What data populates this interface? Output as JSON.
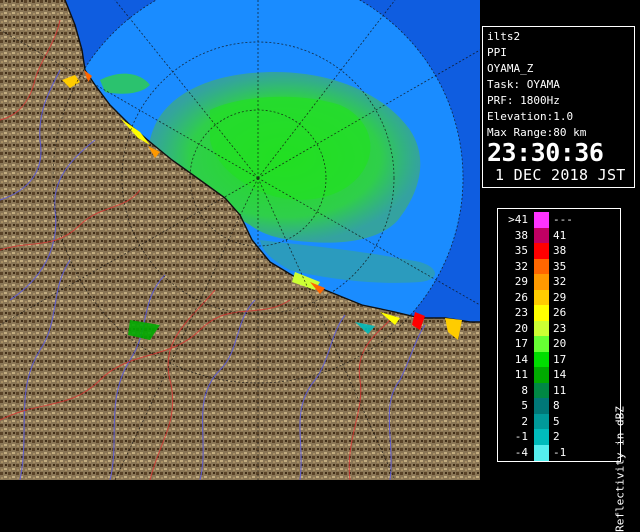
{
  "info": {
    "lines": [
      "ilts2",
      "PPI",
      "OYAMA_Z",
      "Task: OYAMA",
      "PRF: 1800Hz",
      "Elevation:1.0",
      "Max Range:80 km"
    ],
    "time": "23:30:36",
    "date": "1 DEC 2018 JST"
  },
  "legend": {
    "unit_label": "Reflectivity in dBZ",
    "rows": [
      {
        "low": ">41",
        "high": "---",
        "color": "#ff33ff"
      },
      {
        "low": "38",
        "high": "41",
        "color": "#c00063"
      },
      {
        "low": "35",
        "high": "38",
        "color": "#ff0000"
      },
      {
        "low": "32",
        "high": "35",
        "color": "#ff6600"
      },
      {
        "low": "29",
        "high": "32",
        "color": "#ff9900"
      },
      {
        "low": "26",
        "high": "29",
        "color": "#ffcc00"
      },
      {
        "low": "23",
        "high": "26",
        "color": "#ffff00"
      },
      {
        "low": "20",
        "high": "23",
        "color": "#ccff33"
      },
      {
        "low": "17",
        "high": "20",
        "color": "#66ff33"
      },
      {
        "low": "14",
        "high": "17",
        "color": "#00dd00"
      },
      {
        "low": "11",
        "high": "14",
        "color": "#00aa00"
      },
      {
        "low": "8",
        "high": "11",
        "color": "#008844"
      },
      {
        "low": "5",
        "high": "8",
        "color": "#007777"
      },
      {
        "low": "2",
        "high": "5",
        "color": "#009999"
      },
      {
        "low": "-1",
        "high": "2",
        "color": "#00bbbb"
      },
      {
        "low": "-4",
        "high": "-1",
        "color": "#55eeee"
      }
    ]
  },
  "map": {
    "sea_color": "#0f5de0",
    "land_color": "#8a7656",
    "coverage_color": "#1a8cff",
    "echo_color": "#3ddb3d"
  }
}
